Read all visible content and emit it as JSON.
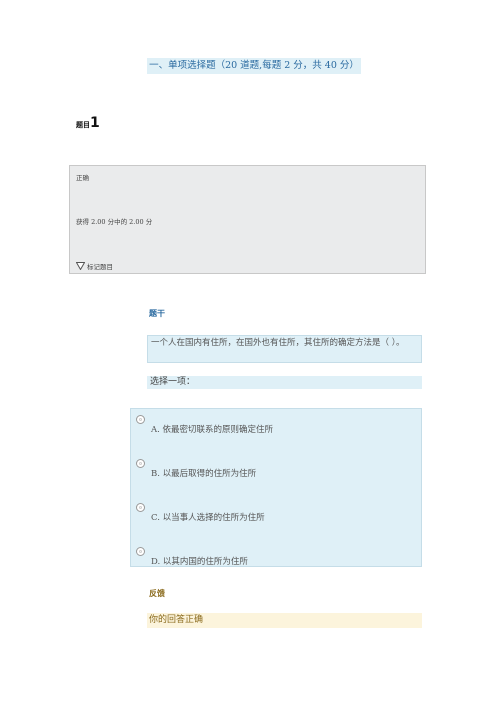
{
  "section": {
    "heading": "一、单项选择题（20 道题,每题 2 分，共 40 分）"
  },
  "question": {
    "label": "题目",
    "number": "1",
    "state": "正确",
    "grade": "获得 2.00 分中的 2.00 分",
    "flag_label": "标记题目",
    "stem_title": "题干",
    "text": "一个人在国内有住所，在国外也有住所，其住所的确定方法是（ ）。",
    "prompt": "选择一项：",
    "options": [
      {
        "text": "A.  依最密切联系的原则确定住所"
      },
      {
        "text": "B.  以最后取得的住所为住所"
      },
      {
        "text": "C.  以当事人选择的住所为住所"
      },
      {
        "text": "D.  以其内国的住所为住所"
      }
    ],
    "feedback_title": "反馈",
    "feedback": "你的回答正确"
  },
  "colors": {
    "accent_blue": "#2a6aa0",
    "feedback_brown": "#8a6a1c",
    "question_bg": "#dff0f7",
    "feedback_bg": "#fcf4dc",
    "info_bg": "#eaebec"
  }
}
